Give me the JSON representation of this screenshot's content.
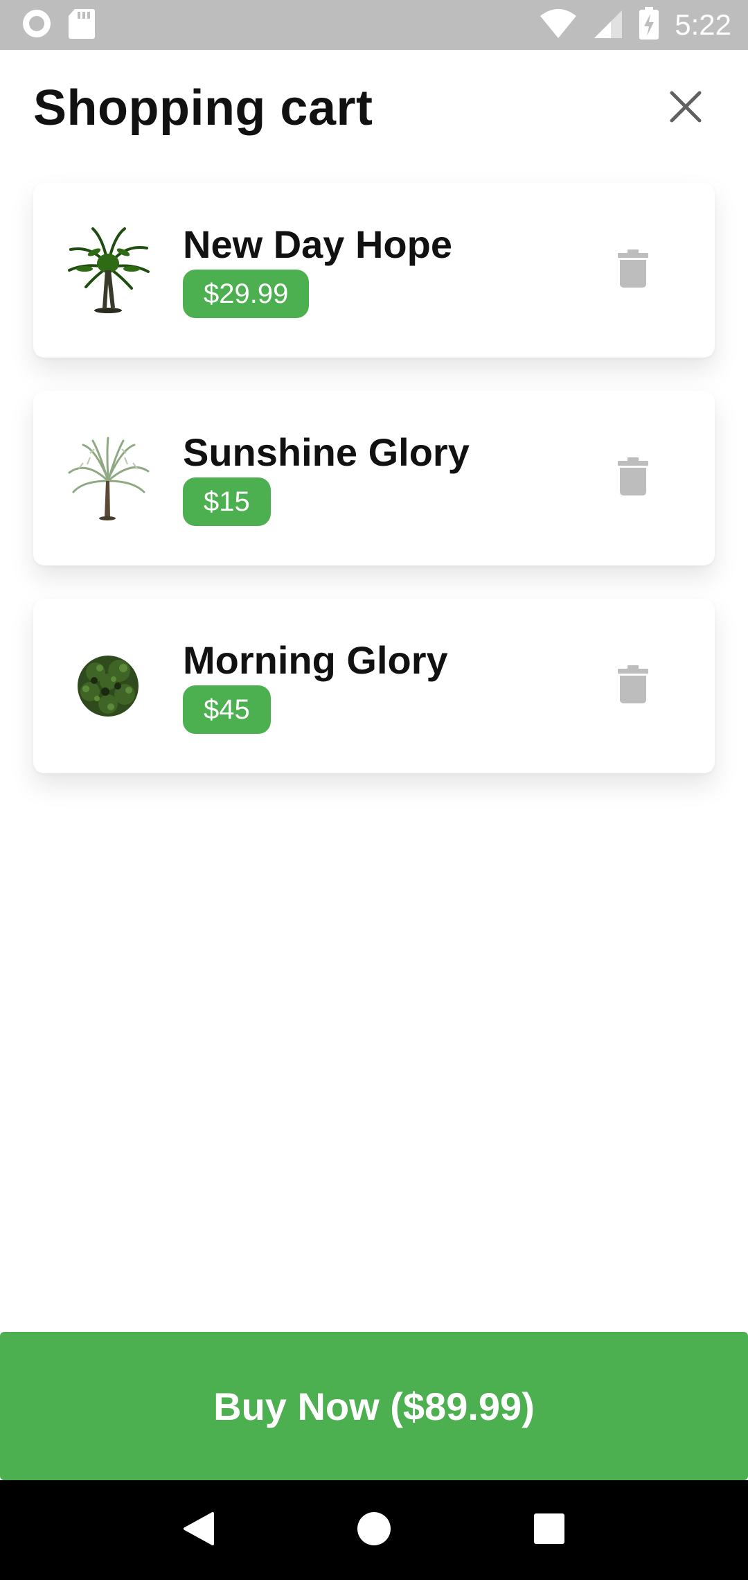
{
  "status_bar": {
    "time": "5:22",
    "icons": [
      "record-icon",
      "sd-card-icon",
      "wifi-icon",
      "signal-icon",
      "battery-charging-icon"
    ]
  },
  "header": {
    "title": "Shopping cart",
    "close_icon": "close-icon"
  },
  "cart": {
    "items": [
      {
        "name": "New Day Hope",
        "price": "$29.99",
        "thumbnail": "palm-tree-image",
        "delete_icon": "trash-icon"
      },
      {
        "name": "Sunshine Glory",
        "price": "$15",
        "thumbnail": "date-palm-image",
        "delete_icon": "trash-icon"
      },
      {
        "name": "Morning Glory",
        "price": "$45",
        "thumbnail": "shrub-image",
        "delete_icon": "trash-icon"
      }
    ]
  },
  "checkout": {
    "buy_label": "Buy Now ($89.99)"
  },
  "nav_bar": {
    "back_icon": "back-icon",
    "home_icon": "home-icon",
    "recents_icon": "recents-icon"
  },
  "colors": {
    "accent": "#4caf50",
    "status_bar": "#bdbdbd",
    "trash": "#bdbdbd",
    "title_text": "#111111"
  }
}
